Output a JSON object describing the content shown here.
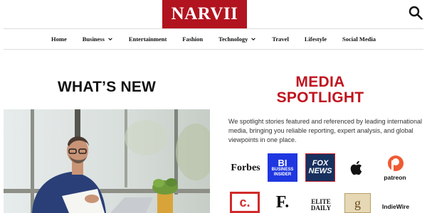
{
  "header": {
    "brand": "NARVII",
    "brand_color": "#b2141f",
    "search_icon": "search-icon"
  },
  "nav": {
    "items": [
      {
        "label": "Home",
        "has_dropdown": false
      },
      {
        "label": "Business",
        "has_dropdown": true
      },
      {
        "label": "Entertainment",
        "has_dropdown": false
      },
      {
        "label": "Fashion",
        "has_dropdown": false
      },
      {
        "label": "Technology",
        "has_dropdown": true
      },
      {
        "label": "Travel",
        "has_dropdown": false
      },
      {
        "label": "Lifestyle",
        "has_dropdown": false
      },
      {
        "label": "Social Media",
        "has_dropdown": false
      }
    ]
  },
  "whats_new": {
    "heading": "WHAT’S NEW",
    "image": "man-reading-document-at-laptop"
  },
  "media_spotlight": {
    "title_line1": "MEDIA",
    "title_line2": "SPOTLIGHT",
    "title_color": "#c0141e",
    "description": "We spotlight stories featured and referenced by leading international media, bringing you reliable reporting, expert analysis, and global viewpoints in one place.",
    "logos": {
      "forbes": "Forbes",
      "bi_mark": "BI",
      "bi_line1": "BUSINESS",
      "bi_line2": "INSIDER",
      "fox_line1": "FOX",
      "fox_line2": "NEWS",
      "apple": "apple-icon",
      "patreon": "patreon",
      "cheddar": "c.",
      "forward": "F.",
      "elite_line1": "ELITE",
      "elite_line2": "DAILY",
      "goodreads": "g",
      "indiewire": "IndieWire"
    }
  }
}
